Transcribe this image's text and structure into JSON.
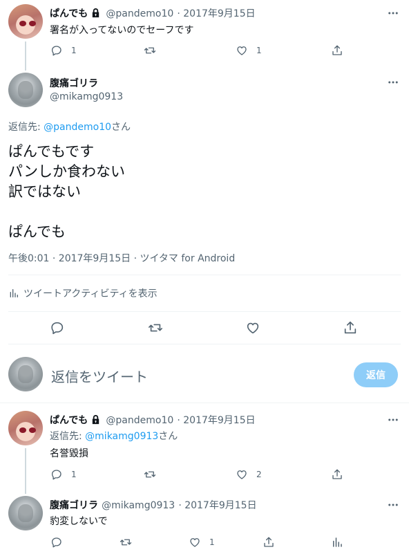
{
  "tweet1": {
    "name": "ぱんでも",
    "handle": "@pandemo10",
    "date": "· 2017年9月15日",
    "text": "署名が入ってないのでセーフです",
    "reply_count": "1",
    "like_count": "1"
  },
  "main_tweet": {
    "name": "腹痛ゴリラ",
    "handle": "@mikamg0913",
    "reply_to_prefix": "返信先: ",
    "reply_to_handle": "@pandemo10",
    "reply_to_suffix": "さん",
    "lines": [
      "ぱんでもです",
      "パンしか食わない",
      "訳ではない",
      "",
      "ぱんでも"
    ],
    "timestamp": "午後0:01 · 2017年9月15日 · ツイタマ for Android",
    "activity_label": "ツイートアクティビティを表示"
  },
  "compose": {
    "placeholder": "返信をツイート",
    "reply_button": "返信"
  },
  "tweet3": {
    "name": "ぱんでも",
    "handle": "@pandemo10",
    "date": "· 2017年9月15日",
    "reply_to_prefix": "返信先: ",
    "reply_to_handle": "@mikamg0913",
    "reply_to_suffix": "さん",
    "text": "名誉毀損",
    "reply_count": "1",
    "like_count": "2"
  },
  "tweet4": {
    "name": "腹痛ゴリラ",
    "handle": "@mikamg0913",
    "date": "· 2017年9月15日",
    "text": "豹変しないで",
    "like_count": "1"
  },
  "icons": [
    "lock-icon",
    "more-icon",
    "reply-icon",
    "retweet-icon",
    "like-icon",
    "share-icon",
    "analytics-icon"
  ],
  "colors": {
    "accent": "#1d9bf0",
    "muted": "#536471",
    "text": "#0f1419",
    "reply_button_disabled": "#8ecdf8"
  }
}
